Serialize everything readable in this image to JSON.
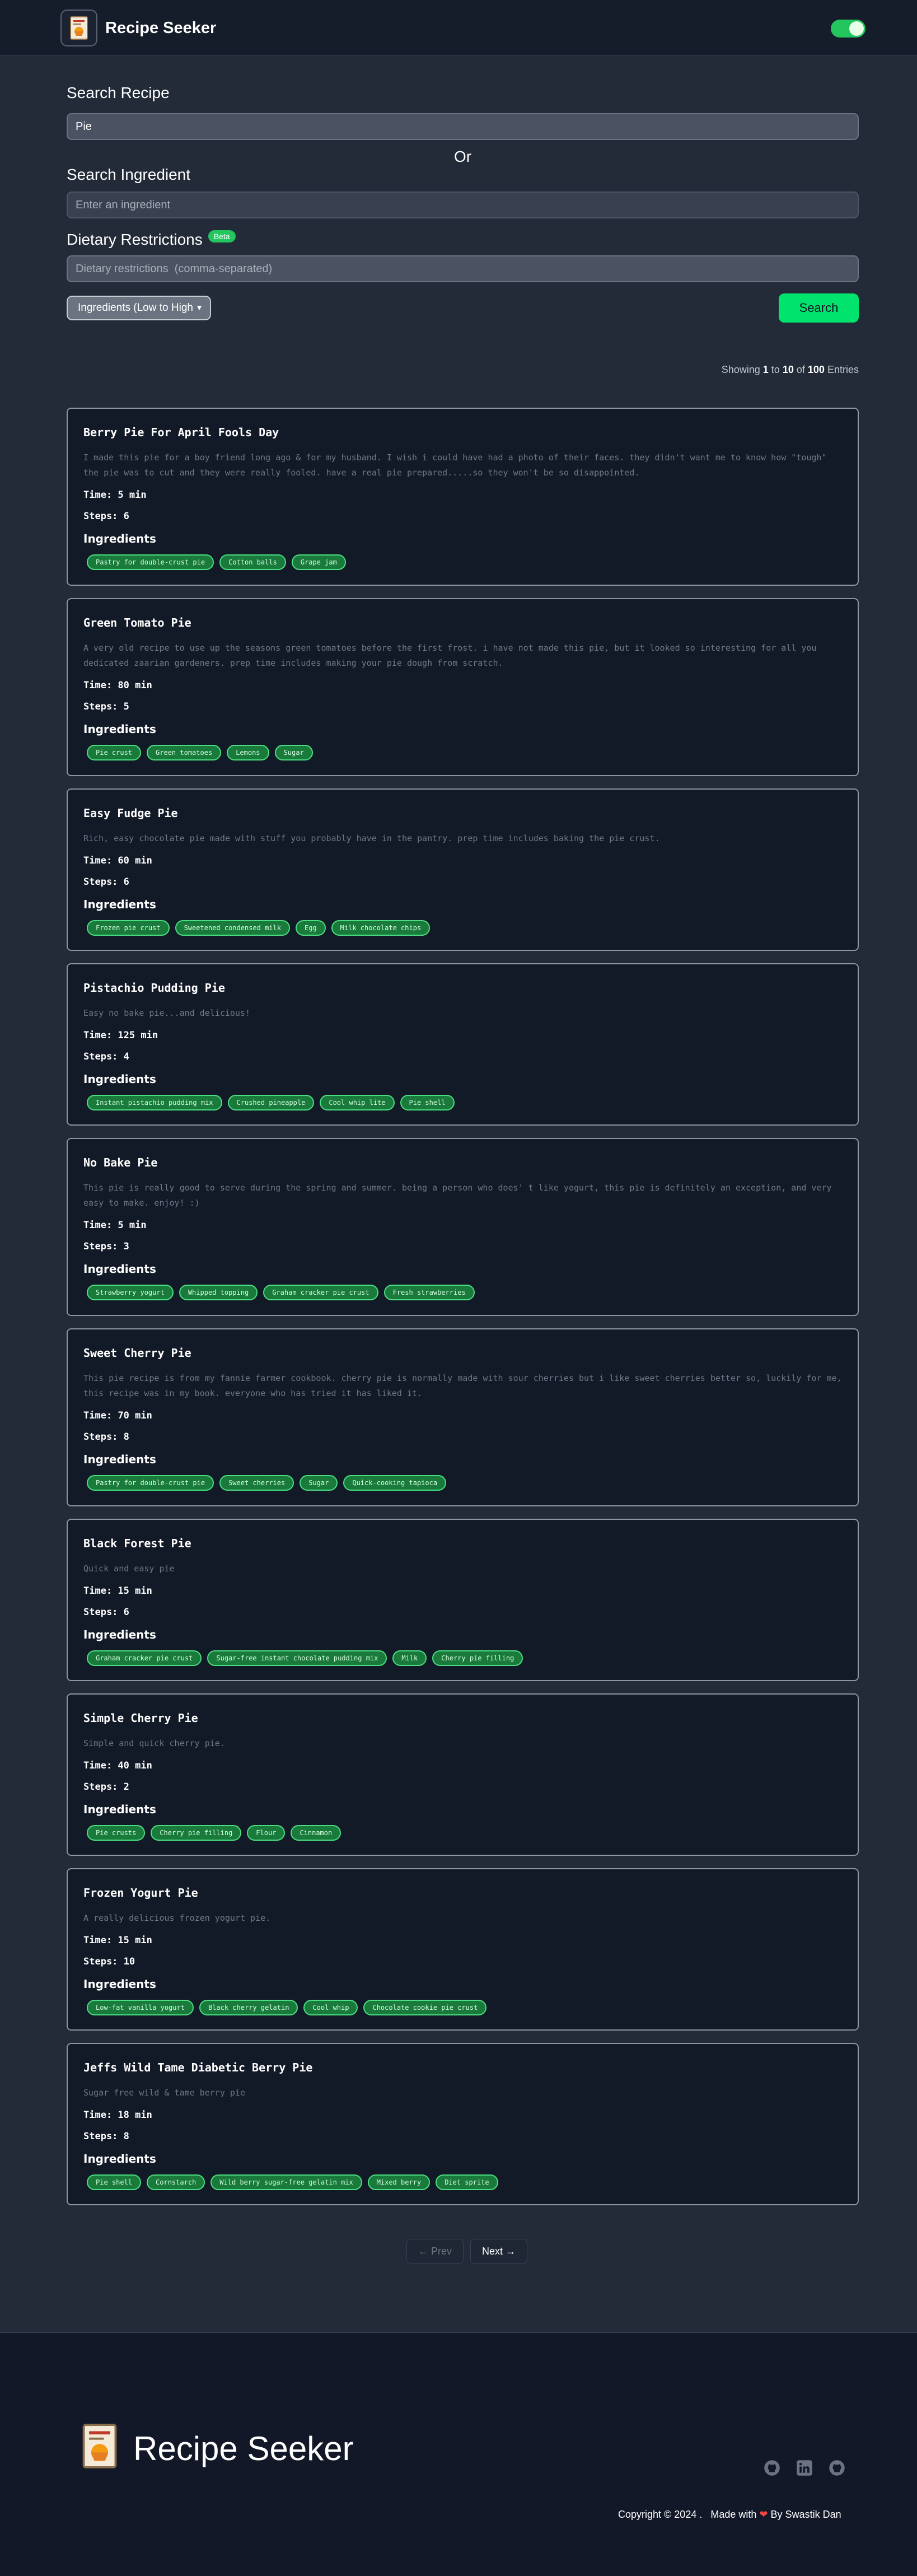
{
  "app": {
    "title": "Recipe Seeker"
  },
  "search": {
    "recipe_label": "Search Recipe",
    "recipe_value": "Pie",
    "or_label": "Or",
    "ingredient_label": "Search Ingredient",
    "ingredient_placeholder": "Enter an ingredient",
    "dietary_label": "Dietary Restrictions",
    "beta_badge": "Beta",
    "dietary_placeholder": "Dietary restrictions  (comma-separated)",
    "sort_selected": "Ingredients (Low to High",
    "search_button": "Search"
  },
  "results": {
    "showing_prefix": "Showing",
    "start": "1",
    "to": "to",
    "end": "10",
    "of": "of",
    "total": "100",
    "suffix": "Entries"
  },
  "labels": {
    "ingredients_heading": "Ingredients"
  },
  "recipes": [
    {
      "title": "Berry Pie For April Fools Day",
      "description": "I made this pie for a boy friend long ago & for my husband. I wish i could have had a photo of their faces. they didn't want me to know how \"tough\" the pie was to cut and they were really fooled. have a real pie prepared.....so they won't be so disappointed.",
      "time": "Time: 5 min",
      "steps": "Steps: 6",
      "ingredients": [
        "Pastry for double-crust pie",
        "Cotton balls",
        "Grape jam"
      ]
    },
    {
      "title": "Green Tomato Pie",
      "description": "A very old recipe to use up the seasons green tomatoes before the first frost. i have not made this pie, but it looked so interesting for all you dedicated zaarian gardeners. prep time includes making your pie dough from scratch.",
      "time": "Time: 80 min",
      "steps": "Steps: 5",
      "ingredients": [
        "Pie crust",
        "Green tomatoes",
        "Lemons",
        "Sugar"
      ]
    },
    {
      "title": "Easy Fudge Pie",
      "description": "Rich, easy chocolate pie made with stuff you probably have in the pantry. prep time includes baking the pie crust.",
      "time": "Time: 60 min",
      "steps": "Steps: 6",
      "ingredients": [
        "Frozen pie crust",
        "Sweetened condensed milk",
        "Egg",
        "Milk chocolate chips"
      ]
    },
    {
      "title": "Pistachio Pudding Pie",
      "description": "Easy no bake pie...and delicious!",
      "time": "Time: 125 min",
      "steps": "Steps: 4",
      "ingredients": [
        "Instant pistachio pudding mix",
        "Crushed pineapple",
        "Cool whip lite",
        "Pie shell"
      ]
    },
    {
      "title": "No Bake Pie",
      "description": "This pie is really good to serve during the spring and summer. being a person who does' t like yogurt, this pie is definitely an exception, and very easy to make. enjoy! :)",
      "time": "Time: 5 min",
      "steps": "Steps: 3",
      "ingredients": [
        "Strawberry yogurt",
        "Whipped topping",
        "Graham cracker pie crust",
        "Fresh strawberries"
      ]
    },
    {
      "title": "Sweet Cherry Pie",
      "description": "This pie recipe is from my fannie farmer cookbook. cherry pie is normally made with sour cherries but i like sweet cherries better so, luckily for me, this recipe was in my book. everyone who has tried it has liked it.",
      "time": "Time: 70 min",
      "steps": "Steps: 8",
      "ingredients": [
        "Pastry for double-crust pie",
        "Sweet cherries",
        "Sugar",
        "Quick-cooking tapioca"
      ]
    },
    {
      "title": "Black Forest Pie",
      "description": "Quick and easy pie",
      "time": "Time: 15 min",
      "steps": "Steps: 6",
      "ingredients": [
        "Graham cracker pie crust",
        "Sugar-free instant chocolate pudding mix",
        "Milk",
        "Cherry pie filling"
      ]
    },
    {
      "title": "Simple Cherry Pie",
      "description": "Simple and quick cherry pie.",
      "time": "Time: 40 min",
      "steps": "Steps: 2",
      "ingredients": [
        "Pie crusts",
        "Cherry pie filling",
        "Flour",
        "Cinnamon"
      ]
    },
    {
      "title": "Frozen Yogurt Pie",
      "description": "A really delicious frozen yogurt pie.",
      "time": "Time: 15 min",
      "steps": "Steps: 10",
      "ingredients": [
        "Low-fat vanilla yogurt",
        "Black cherry gelatin",
        "Cool whip",
        "Chocolate cookie pie crust"
      ]
    },
    {
      "title": "Jeffs Wild Tame Diabetic Berry Pie",
      "description": "Sugar free wild & tame berry pie",
      "time": "Time: 18 min",
      "steps": "Steps: 8",
      "ingredients": [
        "Pie shell",
        "Cornstarch",
        "Wild berry sugar-free gelatin mix",
        "Mixed berry",
        "Diet sprite"
      ]
    }
  ],
  "pagination": {
    "prev": "← Prev",
    "next": "Next →"
  },
  "footer": {
    "title": "Recipe Seeker",
    "copyright": "Copyright © 2024 .",
    "made_with": "Made with",
    "author": "By Swastik Dan",
    "socials": [
      "github-icon",
      "linkedin-icon",
      "github-icon"
    ]
  },
  "colors": {
    "accent": "#00e46e",
    "tag_bg": "#1a7a3c",
    "tag_border": "#4ade80",
    "heart": "#ef4444"
  }
}
